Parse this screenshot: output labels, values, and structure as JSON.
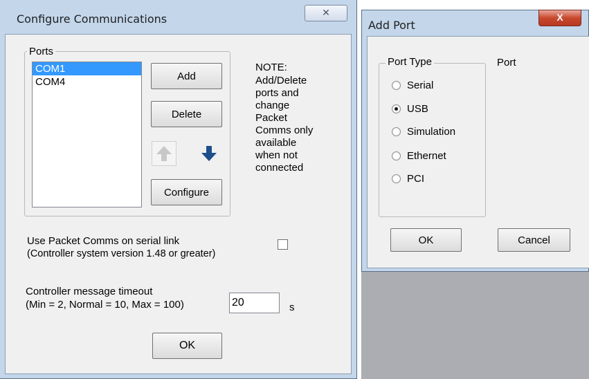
{
  "configure_window": {
    "title": "Configure Communications",
    "close_glyph": "✕",
    "ports_group_label": "Ports",
    "ports": [
      "COM1",
      "COM4"
    ],
    "selected_port": "COM1",
    "add_label": "Add",
    "delete_label": "Delete",
    "configure_label": "Configure",
    "note_lines": [
      "NOTE:",
      "Add/Delete",
      "ports and",
      "change",
      "Packet",
      "Comms only",
      "available",
      "when not",
      "connected"
    ],
    "packet_comms_line1": "Use Packet Comms on serial link",
    "packet_comms_line2": "(Controller system version 1.48 or greater)",
    "packet_comms_checked": false,
    "timeout_line1": "Controller message timeout",
    "timeout_line2": "(Min = 2, Normal = 10, Max = 100)",
    "timeout_value": "20",
    "timeout_unit": "s",
    "ok_label": "OK"
  },
  "add_port_window": {
    "title": "Add Port",
    "close_glyph": "X",
    "port_type_label": "Port Type",
    "port_label": "Port",
    "port_types": [
      {
        "label": "Serial",
        "checked": false
      },
      {
        "label": "USB",
        "checked": true
      },
      {
        "label": "Simulation",
        "checked": false
      },
      {
        "label": "Ethernet",
        "checked": false
      },
      {
        "label": "PCI",
        "checked": false
      }
    ],
    "ok_label": "OK",
    "cancel_label": "Cancel"
  },
  "colors": {
    "frame": "#c3d6ea",
    "dialog_bg": "#f0f0f0",
    "selection": "#3399ff",
    "arrow_active": "#1f4e8c",
    "arrow_disabled": "#c8c8c8",
    "close_red": "#c9482e"
  },
  "icons": {
    "move_up": "arrow-up-icon",
    "move_down": "arrow-down-icon"
  }
}
